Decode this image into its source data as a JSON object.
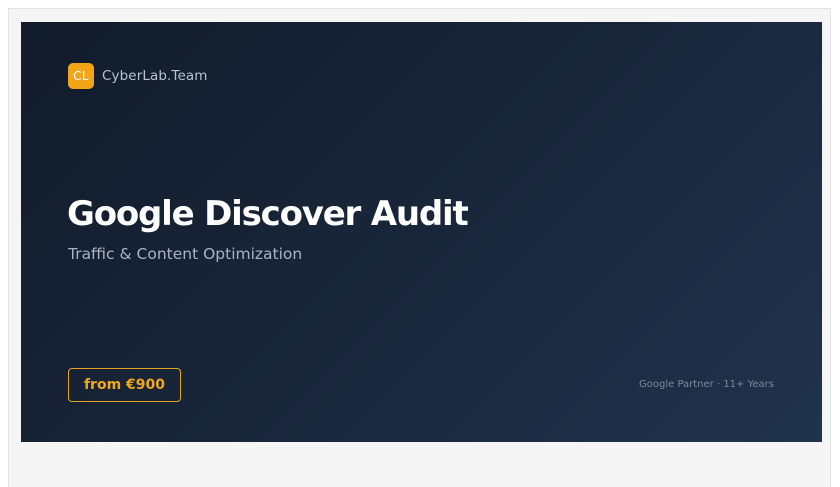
{
  "brand": {
    "logo_text": "CL",
    "name": "CyberLab.Team"
  },
  "hero": {
    "title": "Google Discover Audit",
    "subtitle": "Traffic & Content Optimization"
  },
  "price": {
    "label": "from €900"
  },
  "meta": {
    "text": "Google Partner · 11+ Years"
  },
  "colors": {
    "accent": "#f2a516",
    "banner_dark": "#111b2a",
    "banner_light": "#21324d",
    "frame_bg": "#f5f5f5"
  }
}
